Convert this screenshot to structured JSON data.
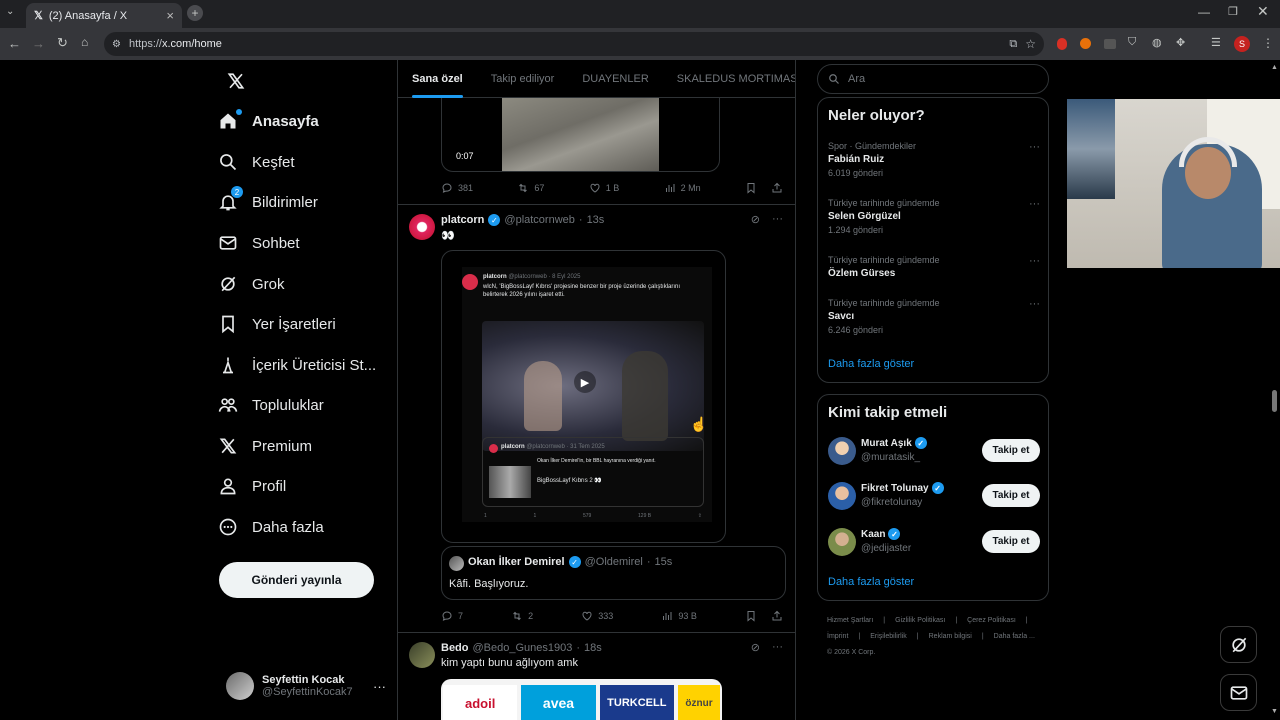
{
  "browser": {
    "tab_title": "(2) Anasayfa / X",
    "url_prefix": "https://",
    "url_host": "x.com/home",
    "profile_letter": "S"
  },
  "nav": {
    "items": [
      {
        "label": "Anasayfa",
        "icon": "home-icon"
      },
      {
        "label": "Keşfet",
        "icon": "search-icon"
      },
      {
        "label": "Bildirimler",
        "icon": "bell-icon",
        "badge": "2"
      },
      {
        "label": "Sohbet",
        "icon": "mail-icon"
      },
      {
        "label": "Grok",
        "icon": "grok-icon"
      },
      {
        "label": "Yer İşaretleri",
        "icon": "bookmark-icon"
      },
      {
        "label": "İçerik Üreticisi St...",
        "icon": "creator-studio-icon"
      },
      {
        "label": "Topluluklar",
        "icon": "communities-icon"
      },
      {
        "label": "Premium",
        "icon": "x-icon"
      },
      {
        "label": "Profil",
        "icon": "person-icon"
      },
      {
        "label": "Daha fazla",
        "icon": "more-circle-icon"
      }
    ],
    "post_button": "Gönderi yayınla",
    "me": {
      "name": "Seyfettin Kocak",
      "handle": "@SeyfettinKocak7",
      "menu": "···"
    }
  },
  "timeline": {
    "tabs": [
      "Sana özel",
      "Takip ediliyor",
      "DUAYENLER",
      "SKALEDUS MORTIMAS"
    ],
    "first_media": {
      "duration": "0:07"
    },
    "first_actions": {
      "reply": "381",
      "retweet": "67",
      "like": "1 B",
      "views": "2 Mn"
    },
    "tweet2": {
      "name": "platcorn",
      "handle": "@platcornweb",
      "time": "13s",
      "text": "👀",
      "quoted": {
        "name": "platcorn",
        "handle": "@platcornweb · 8 Eyl 2025",
        "text": "wlcN, 'BigBossLayf Kıbrıs' projesine benzer bir proje üzerinde çalıştıklarını belirterek 2026 yılını işaret etti.",
        "nested_name": "platcorn",
        "nested_handle": "@platcornweb · 31 Tem 2025",
        "nested_text1": "Okan İlker Demirel'in, bir BBL hayranına verdiği yanıt.",
        "nested_text2": "BigBossLayf Kıbrıs 2 👀",
        "mini_stats": [
          "1",
          "1",
          "579",
          "129 B"
        ]
      },
      "quote_tweet": {
        "name": "Okan İlker Demirel",
        "handle": "@Oldemirel",
        "time": "15s",
        "text": "Kâfi. Başlıyoruz."
      },
      "actions": {
        "reply": "7",
        "retweet": "2",
        "like": "333",
        "views": "93 B"
      }
    },
    "tweet3": {
      "name": "Bedo",
      "handle": "@Bedo_Gunes1903",
      "time": "18s",
      "text": "kim yaptı bunu ağlıyom amk",
      "logos": [
        "adoil",
        "avea",
        "TURKCELL",
        "öznur"
      ]
    },
    "sep": "·",
    "more": "···"
  },
  "sidebar": {
    "search_placeholder": "Ara",
    "trends_title": "Neler oluyor?",
    "trends": [
      {
        "context": "Spor · Gündemdekiler",
        "name": "Fabián Ruiz",
        "count": "6.019 gönderi"
      },
      {
        "context": "Türkiye tarihinde gündemde",
        "name": "Selen Görgüzel",
        "count": "1.294 gönderi"
      },
      {
        "context": "Türkiye tarihinde gündemde",
        "name": "Özlem Gürses",
        "count": ""
      },
      {
        "context": "Türkiye tarihinde gündemde",
        "name": "Savcı",
        "count": "6.246 gönderi"
      }
    ],
    "show_more": "Daha fazla göster",
    "who_title": "Kimi takip etmeli",
    "who": [
      {
        "name": "Murat Aşık",
        "handle": "@muratasik_",
        "button": "Takip et",
        "color": "#3a5b8c"
      },
      {
        "name": "Fikret Tolunay",
        "handle": "@fikretolunay",
        "button": "Takip et",
        "color": "#2b5fa8"
      },
      {
        "name": "Kaan",
        "handle": "@jedijaster",
        "button": "Takip et",
        "color": "#7a8c4a"
      }
    ],
    "who_more": "Daha fazla göster",
    "footer": [
      "Hizmet Şartları",
      "|",
      "Gizlilik Politikası",
      "|",
      "Çerez Politikası",
      "|",
      "İmprint",
      "|",
      "Erişilebilirlik",
      "|",
      "Reklam bilgisi",
      "|",
      "Daha fazla ...",
      "© 2026 X Corp."
    ]
  },
  "colors": {
    "accent": "#1d9bf0",
    "bg": "#000000",
    "border": "#2f3336",
    "muted": "#71767b"
  }
}
